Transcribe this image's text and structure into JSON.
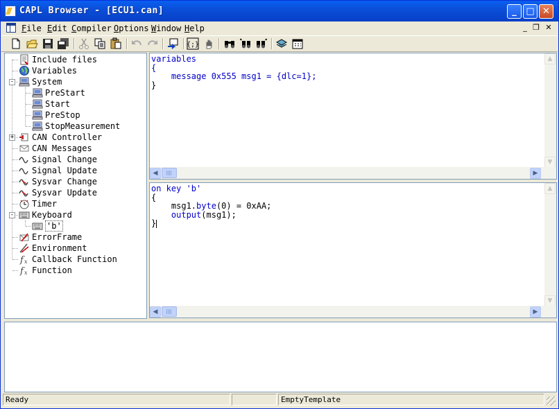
{
  "window": {
    "title": "CAPL Browser - [ECU1.can]"
  },
  "title_buttons": {
    "minimize": "_",
    "maximize": "□",
    "close": "✕"
  },
  "menu": {
    "items": [
      {
        "key": "F",
        "rest": "ile"
      },
      {
        "key": "E",
        "rest": "dit"
      },
      {
        "key": "C",
        "rest": "ompiler"
      },
      {
        "key": "O",
        "rest": "ptions"
      },
      {
        "key": "W",
        "rest": "indow"
      },
      {
        "key": "H",
        "rest": "elp"
      }
    ],
    "mdi_buttons": {
      "minimize": "_",
      "restore": "❐",
      "close": "✕"
    }
  },
  "toolbar": {
    "icons": [
      "new-file-icon",
      "open-folder-icon",
      "save-icon",
      "save-all-icon",
      "cut-icon",
      "copy-icon",
      "paste-icon",
      "undo-icon",
      "redo-icon",
      "goto-icon",
      "compile-icon",
      "hand-icon",
      "find-icon",
      "find-next-icon",
      "find-prev-icon",
      "stack-icon",
      "calendar-icon"
    ]
  },
  "tree": {
    "items": [
      {
        "label": "Include files",
        "icon": "include-files-icon",
        "level": 0
      },
      {
        "label": "Variables",
        "icon": "globe-icon",
        "level": 0
      },
      {
        "label": "System",
        "icon": "computer-icon",
        "level": 0,
        "expander": "-"
      },
      {
        "label": "PreStart",
        "icon": "computer-icon",
        "level": 1
      },
      {
        "label": "Start",
        "icon": "computer-icon",
        "level": 1
      },
      {
        "label": "PreStop",
        "icon": "computer-icon",
        "level": 1
      },
      {
        "label": "StopMeasurement",
        "icon": "computer-icon",
        "level": 1
      },
      {
        "label": "CAN Controller",
        "icon": "can-controller-icon",
        "level": 0,
        "expander": "+"
      },
      {
        "label": "CAN Messages",
        "icon": "envelope-icon",
        "level": 0
      },
      {
        "label": "Signal Change",
        "icon": "wave-icon",
        "level": 0
      },
      {
        "label": "Signal Update",
        "icon": "wave-icon",
        "level": 0
      },
      {
        "label": "Sysvar Change",
        "icon": "sysvar-icon",
        "level": 0
      },
      {
        "label": "Sysvar Update",
        "icon": "sysvar-icon",
        "level": 0
      },
      {
        "label": "Timer",
        "icon": "clock-icon",
        "level": 0
      },
      {
        "label": "Keyboard",
        "icon": "keyboard-icon",
        "level": 0,
        "expander": "-"
      },
      {
        "label": "'b'",
        "icon": "keyboard-icon",
        "level": 1,
        "selected": true
      },
      {
        "label": "ErrorFrame",
        "icon": "error-frame-icon",
        "level": 0
      },
      {
        "label": "Environment",
        "icon": "environment-icon",
        "level": 0
      },
      {
        "label": "Callback Function",
        "icon": "function-icon",
        "level": 0
      },
      {
        "label": "Function",
        "icon": "function-icon",
        "level": 0
      }
    ]
  },
  "editor_variables": {
    "lines": [
      [
        {
          "t": "variables",
          "kw": true
        }
      ],
      [
        {
          "t": "{",
          "kw": true
        }
      ],
      [
        {
          "t": "    message 0x555 msg1 = {",
          "kw": true
        },
        {
          "t": "dlc",
          "kw": true
        },
        {
          "t": "=1};",
          "kw": true
        }
      ],
      [
        {
          "t": "}"
        }
      ]
    ]
  },
  "editor_handler": {
    "lines": [
      [
        {
          "t": "on key 'b'",
          "kw": true
        }
      ],
      [
        {
          "t": "{"
        }
      ],
      [
        {
          "t": "    msg1."
        },
        {
          "t": "byte",
          "kw": true
        },
        {
          "t": "(0) = 0xAA;"
        }
      ],
      [
        {
          "t": "    "
        },
        {
          "t": "output",
          "kw": true
        },
        {
          "t": "(msg1);"
        }
      ],
      [
        {
          "t": "}"
        }
      ]
    ]
  },
  "status": {
    "left": "Ready",
    "middle": "",
    "right": "EmptyTemplate"
  },
  "colors": {
    "keyword": "#0000c8",
    "titlebar": "#0a5ff2",
    "face": "#ece9d8"
  }
}
